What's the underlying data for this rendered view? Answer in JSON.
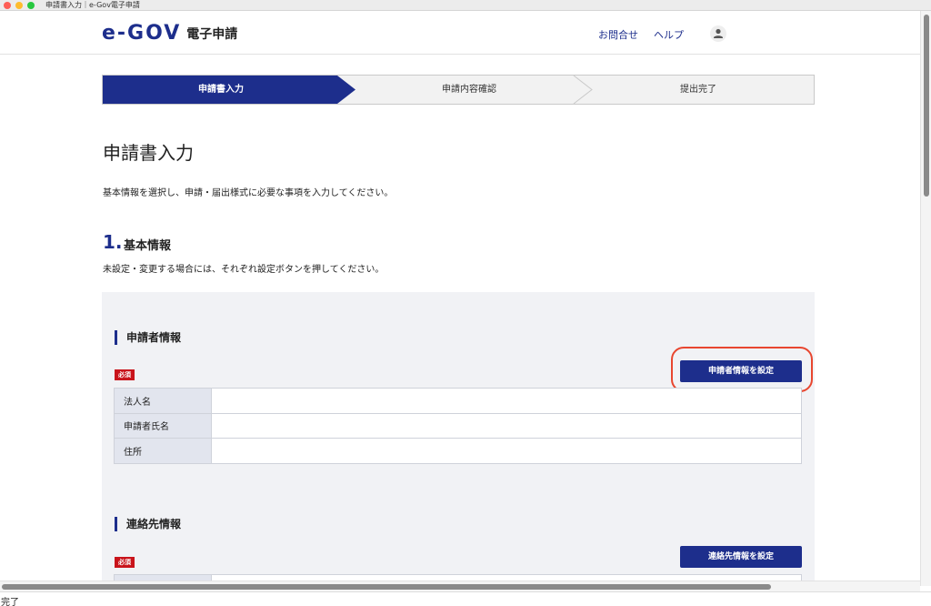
{
  "window": {
    "title": "申請書入力｜e-Gov電子申請"
  },
  "header": {
    "logo_mark": "e-GOV",
    "logo_text": "電子申請",
    "contact_label": "お問合せ",
    "help_label": "ヘルプ"
  },
  "stepper": {
    "steps": [
      {
        "label": "申請書入力",
        "active": true
      },
      {
        "label": "申請内容確認",
        "active": false
      },
      {
        "label": "提出完了",
        "active": false
      }
    ]
  },
  "page": {
    "title": "申請書入力",
    "intro": "基本情報を選択し、申請・届出様式に必要な事項を入力してください。"
  },
  "section1": {
    "number": "1.",
    "title": "基本情報",
    "description": "未設定・変更する場合には、それぞれ設定ボタンを押してください。",
    "applicant": {
      "heading": "申請者情報",
      "required_badge": "必須",
      "button_label": "申請者情報を設定",
      "rows": [
        {
          "label": "法人名",
          "value": ""
        },
        {
          "label": "申請者氏名",
          "value": ""
        },
        {
          "label": "住所",
          "value": ""
        }
      ]
    },
    "contact": {
      "heading": "連絡先情報",
      "required_badge": "必須",
      "button_label": "連絡先情報を設定"
    }
  },
  "status_bar": {
    "text": "完了"
  },
  "colors": {
    "brand": "#1d2e8c",
    "required": "#c9141b",
    "highlight": "#e8462f"
  }
}
